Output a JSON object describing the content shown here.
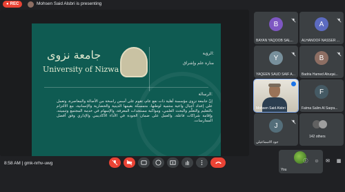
{
  "topbar": {
    "rec_label": "REC",
    "presenting_text": "Mohsen Said Alsbri is presenting"
  },
  "slide": {
    "university_ar": "جامعة نزوى",
    "university_en": "University of Nizwa",
    "vision_heading": "الرؤية:",
    "vision_text": "منارة علم وإشراق",
    "mission_heading": "الرسالة:",
    "mission_text": "إنّ جامعة نزوى مؤسسة أهلية ذات نفع عام، تقوم على أسس راسخة من الأصالة والمعاصرة، وتعمل على إعداد أجيال واعية منتمية لوطنها، متمسكة بقيمها الدينية والحضارية والإنسانية، مع الالتزام بالتعليم والتعلّم والبحث العلمي، ومواكبة مستجدات المعرفة، والإسهام في خدمة المجتمع وتنميته، وإقامة شراكات فاعلة، والعمل على ضمان الجودة في الأداء الأكاديمي والإداري وفق أفضل الممارسات."
  },
  "participants": [
    {
      "name": "BAYAN YAQOOB SAL...",
      "initial": "B",
      "color": "#7e57c2"
    },
    {
      "name": "ALHANOOF NASSER ...",
      "initial": "A",
      "color": "#5c6bc0"
    },
    {
      "name": "YAQEEN SAUD SAIF A...",
      "initial": "Y",
      "color": "#78909c"
    },
    {
      "name": "Badria Hamed Alruqai...",
      "initial": "B",
      "color": "#8d6e63"
    },
    {
      "name": "Mohsen Said Alsbri",
      "initial": "",
      "color": ""
    },
    {
      "name": "Fatma Salim Al Saqra...",
      "initial": "F",
      "color": "#455a64"
    },
    {
      "name": "جود الاسماعيلي",
      "initial": "J",
      "color": "#546e7a"
    },
    {
      "name": "142 others",
      "initial": "",
      "color": ""
    }
  ],
  "self_view": {
    "label": "You"
  },
  "bottombar": {
    "time": "8:58 AM",
    "separator": "|",
    "meeting_code": "gmk-nrhv-uwg"
  },
  "controls": {
    "mic_icon": "mic-off-icon",
    "cam_icon": "cam-off-icon",
    "cc_icon": "captions-icon",
    "emoji_icon": "emoji-icon",
    "present_icon": "present-icon",
    "hand_icon": "raise-hand-icon",
    "more_icon": "more-vert-icon",
    "end_icon": "end-call-icon"
  }
}
